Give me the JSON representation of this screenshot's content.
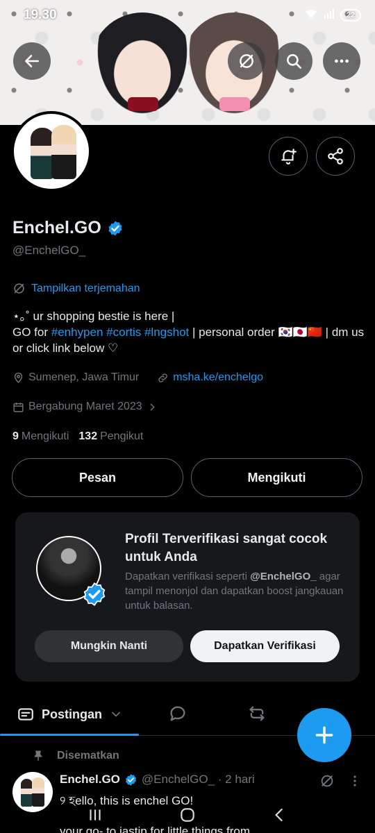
{
  "status_bar": {
    "time": "19.30",
    "battery": "22"
  },
  "profile": {
    "display_name": "Enchel.GO",
    "handle": "@EnchelGO_",
    "translate_label": "Tampilkan terjemahan",
    "bio": {
      "line1": "⋆｡˚ ur shopping bestie is here |",
      "go_for": "GO for ",
      "tags": [
        "#enhypen",
        "#cortis",
        "#lngshot"
      ],
      "after_tags": " | personal order 🇰🇷🇯🇵🇨🇳 | dm us or click link below ♡"
    },
    "location": "Sumenep, Jawa Timur",
    "link": "msha.ke/enchelgo",
    "joined": "Bergabung Maret 2023",
    "following_count": "9",
    "following_label": "Mengikuti",
    "followers_count": "132",
    "followers_label": "Pengikut"
  },
  "actions": {
    "message_label": "Pesan",
    "following_button_label": "Mengikuti"
  },
  "verification_card": {
    "title": "Profil Terverifikasi sangat cocok untuk Anda",
    "desc_pre": "Dapatkan verifikasi seperti ",
    "desc_handle": "@EnchelGO_",
    "desc_post": " agar tampil menonjol dan dapatkan boost jangkauan untuk balasan.",
    "later_label": "Mungkin Nanti",
    "verify_label": "Dapatkan Verifikasi"
  },
  "tabs": {
    "posts_label": "Postingan"
  },
  "post": {
    "pinned_label": "Disematkan",
    "author": "Enchel.GO",
    "meta": "@EnchelGO_ · 2 hari",
    "text": "୨ হello, this is enchel GO!",
    "text2": "your go- to jastip for little things from"
  },
  "colors": {
    "accent": "#1d9bf0",
    "background": "#000000",
    "muted": "#71767b"
  }
}
